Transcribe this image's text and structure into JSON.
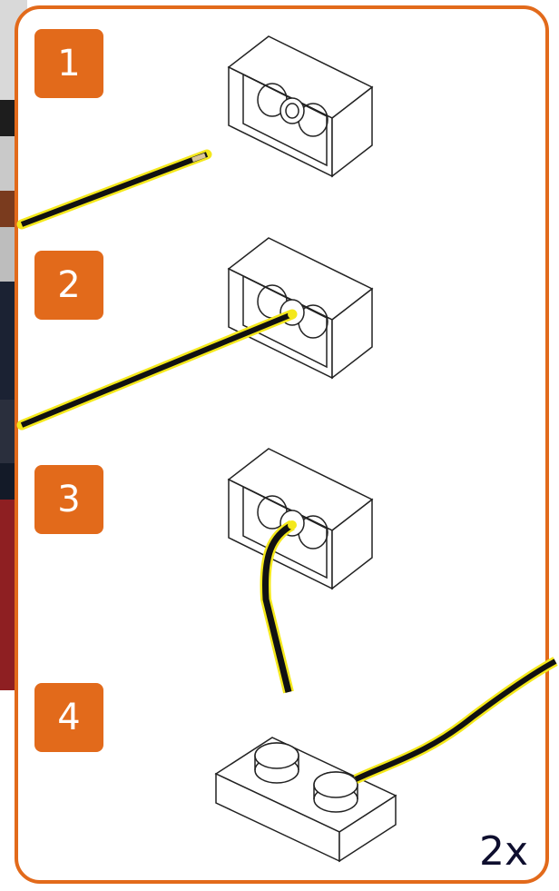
{
  "steps": [
    {
      "number": "1"
    },
    {
      "number": "2"
    },
    {
      "number": "3"
    },
    {
      "number": "4"
    }
  ],
  "quantity": "2x",
  "colors": {
    "accent": "#e26a1b",
    "wire": "#111111",
    "wire_glow": "#f4e81c",
    "quantity_text": "#0e0e2e"
  }
}
